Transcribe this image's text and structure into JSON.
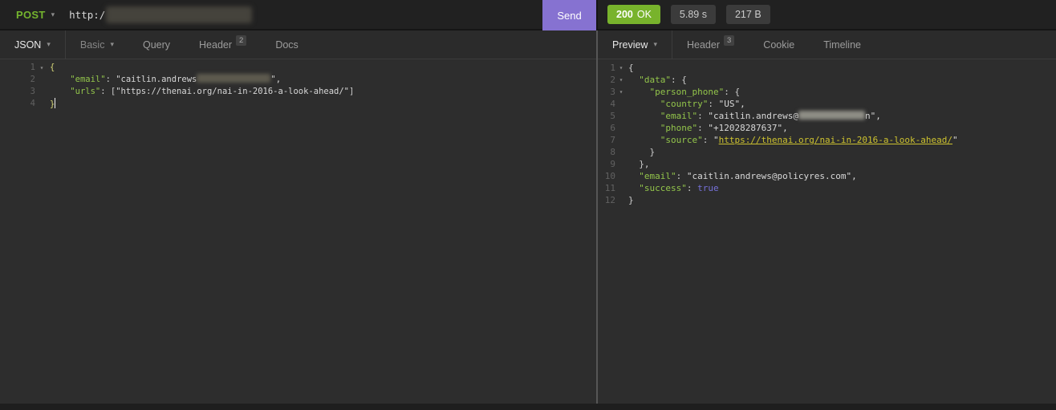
{
  "topbar": {
    "method": "POST",
    "url_visible": "http:/",
    "send_label": "Send",
    "status": {
      "code": "200",
      "text": "OK"
    },
    "time": "5.89 s",
    "size": "217 B"
  },
  "request_panel": {
    "tabs": [
      {
        "label": "JSON",
        "type": "dropdown",
        "active": true
      },
      {
        "label": "Basic",
        "type": "dropdown"
      },
      {
        "label": "Query"
      },
      {
        "label": "Header",
        "badge": "2"
      },
      {
        "label": "Docs"
      }
    ],
    "editor": {
      "lines": [
        {
          "num": 1,
          "fold": true,
          "tokens": [
            {
              "t": "brace",
              "v": "{"
            }
          ]
        },
        {
          "num": 2,
          "tokens": [
            {
              "t": "punc",
              "v": "    "
            },
            {
              "t": "key",
              "v": "\"email\""
            },
            {
              "t": "punc",
              "v": ": "
            },
            {
              "t": "str",
              "v": "\"caitlin.andrews"
            },
            {
              "t": "redact",
              "w": 92,
              "c": "#5d5a4e"
            },
            {
              "t": "str",
              "v": "\","
            }
          ]
        },
        {
          "num": 3,
          "tokens": [
            {
              "t": "punc",
              "v": "    "
            },
            {
              "t": "key",
              "v": "\"urls\""
            },
            {
              "t": "punc",
              "v": ": ["
            },
            {
              "t": "str",
              "v": "\"https://thenai.org/nai-in-2016-a-look-ahead/\""
            },
            {
              "t": "punc",
              "v": "]"
            }
          ]
        },
        {
          "num": 4,
          "tokens": [
            {
              "t": "brace",
              "v": "}"
            },
            {
              "t": "cursor"
            }
          ]
        }
      ]
    }
  },
  "response_panel": {
    "tabs": [
      {
        "label": "Preview",
        "type": "dropdown",
        "active": true
      },
      {
        "label": "Header",
        "badge": "3"
      },
      {
        "label": "Cookie"
      },
      {
        "label": "Timeline"
      }
    ],
    "editor": {
      "lines": [
        {
          "num": 1,
          "fold": true,
          "tokens": [
            {
              "t": "punc",
              "v": "{"
            }
          ]
        },
        {
          "num": 2,
          "fold": true,
          "tokens": [
            {
              "t": "punc",
              "v": "  "
            },
            {
              "t": "key",
              "v": "\"data\""
            },
            {
              "t": "punc",
              "v": ": {"
            }
          ]
        },
        {
          "num": 3,
          "fold": true,
          "tokens": [
            {
              "t": "punc",
              "v": "    "
            },
            {
              "t": "key",
              "v": "\"person_phone\""
            },
            {
              "t": "punc",
              "v": ": {"
            }
          ]
        },
        {
          "num": 4,
          "tokens": [
            {
              "t": "punc",
              "v": "      "
            },
            {
              "t": "key",
              "v": "\"country\""
            },
            {
              "t": "punc",
              "v": ": "
            },
            {
              "t": "str",
              "v": "\"US\","
            }
          ]
        },
        {
          "num": 5,
          "tokens": [
            {
              "t": "punc",
              "v": "      "
            },
            {
              "t": "key",
              "v": "\"email\""
            },
            {
              "t": "punc",
              "v": ": "
            },
            {
              "t": "str",
              "v": "\"caitlin.andrews@"
            },
            {
              "t": "redact",
              "w": 83,
              "c": "#8f8e86"
            },
            {
              "t": "str",
              "v": "n\","
            }
          ]
        },
        {
          "num": 6,
          "tokens": [
            {
              "t": "punc",
              "v": "      "
            },
            {
              "t": "key",
              "v": "\"phone\""
            },
            {
              "t": "punc",
              "v": ": "
            },
            {
              "t": "str",
              "v": "\"+12028287637\","
            }
          ]
        },
        {
          "num": 7,
          "tokens": [
            {
              "t": "punc",
              "v": "      "
            },
            {
              "t": "key",
              "v": "\"source\""
            },
            {
              "t": "punc",
              "v": ": "
            },
            {
              "t": "str",
              "v": "\""
            },
            {
              "t": "link",
              "v": "https://thenai.org/nai-in-2016-a-look-ahead/"
            },
            {
              "t": "str",
              "v": "\""
            }
          ]
        },
        {
          "num": 8,
          "tokens": [
            {
              "t": "punc",
              "v": "    }"
            }
          ]
        },
        {
          "num": 9,
          "tokens": [
            {
              "t": "punc",
              "v": "  },"
            }
          ]
        },
        {
          "num": 10,
          "tokens": [
            {
              "t": "punc",
              "v": "  "
            },
            {
              "t": "key",
              "v": "\"email\""
            },
            {
              "t": "punc",
              "v": ": "
            },
            {
              "t": "str",
              "v": "\"caitlin.andrews@policyres.com\","
            }
          ]
        },
        {
          "num": 11,
          "tokens": [
            {
              "t": "punc",
              "v": "  "
            },
            {
              "t": "key",
              "v": "\"success\""
            },
            {
              "t": "punc",
              "v": ": "
            },
            {
              "t": "bool",
              "v": "true"
            }
          ]
        },
        {
          "num": 12,
          "tokens": [
            {
              "t": "punc",
              "v": "}"
            }
          ]
        }
      ]
    }
  },
  "colors": {
    "method_green": "#74b42e",
    "send_purple": "#8672d1",
    "status_green": "#78b32c",
    "key_green": "#93c54b",
    "link_yellow": "#cdc22f",
    "bool_purple": "#7671d9",
    "redact_url": "#45433c"
  }
}
